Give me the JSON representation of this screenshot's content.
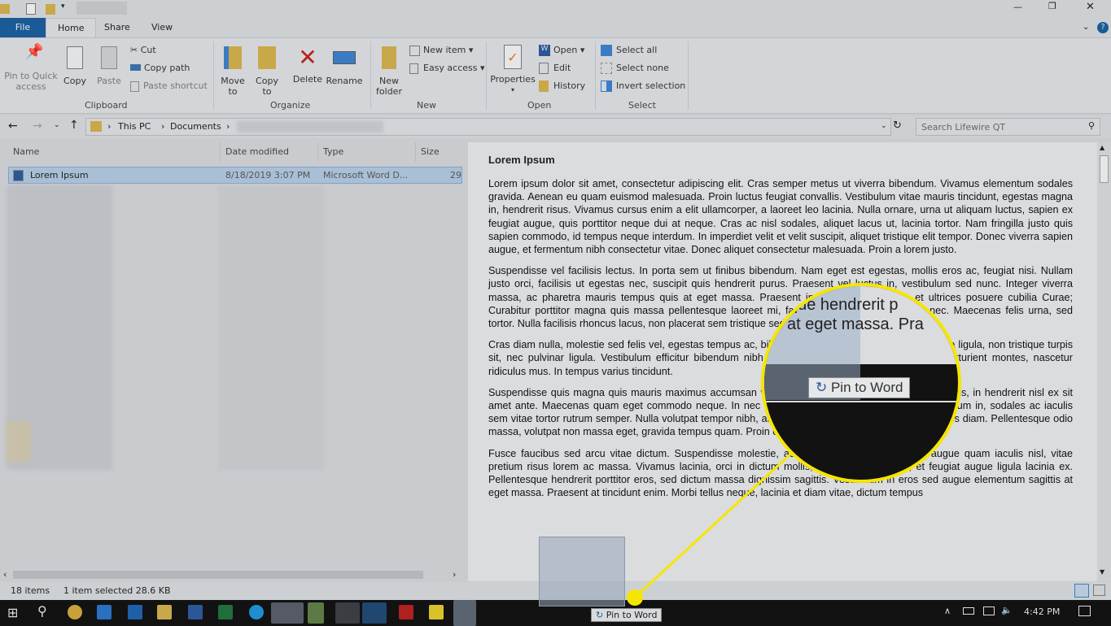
{
  "titlebar": {
    "minimize": "—",
    "restore": "❐",
    "close": "✕"
  },
  "tabs": [
    {
      "label": "File"
    },
    {
      "label": "Home"
    },
    {
      "label": "Share"
    },
    {
      "label": "View"
    }
  ],
  "ribbon": {
    "clipboard": {
      "pin": "Pin to Quick access",
      "copy": "Copy",
      "paste": "Paste",
      "cut": "Cut",
      "copy_path": "Copy path",
      "paste_shortcut": "Paste shortcut",
      "group": "Clipboard"
    },
    "organize": {
      "move": "Move to",
      "copy": "Copy to",
      "delete": "Delete",
      "rename": "Rename",
      "group": "Organize"
    },
    "new": {
      "new_folder": "New folder",
      "new_item": "New item ▾",
      "easy_access": "Easy access ▾",
      "group": "New"
    },
    "open": {
      "properties": "Properties",
      "open": "Open ▾",
      "edit": "Edit",
      "history": "History",
      "group": "Open"
    },
    "select": {
      "select_all": "Select all",
      "select_none": "Select none",
      "invert": "Invert selection",
      "group": "Select"
    }
  },
  "address": {
    "crumbs": [
      "This PC",
      "Documents"
    ],
    "search_placeholder": "Search Lifewire QT"
  },
  "columns": {
    "name": "Name",
    "date": "Date modified",
    "type": "Type",
    "size": "Size"
  },
  "file": {
    "name": "Lorem Ipsum",
    "date": "8/18/2019 3:07 PM",
    "type": "Microsoft Word D...",
    "size": "29"
  },
  "preview": {
    "title": "Lorem Ipsum",
    "paragraphs": [
      "Lorem ipsum dolor sit amet, consectetur adipiscing elit. Cras semper metus ut viverra bibendum. Vivamus elementum sodales gravida. Aenean eu quam euismod malesuada. Proin luctus feugiat convallis. Vestibulum vitae mauris tincidunt, egestas magna in, hendrerit risus. Vivamus cursus enim a elit ullamcorper, a laoreet leo lacinia. Nulla ornare, urna ut aliquam luctus, sapien ex feugiat augue, quis porttitor neque dui at neque. Cras ac nisl sodales, aliquet lacus ut, lacinia tortor. Nam fringilla justo quis sapien commodo, id tempus neque interdum. In imperdiet velit et velit suscipit, aliquet tristique elit tempor. Donec viverra sapien augue, et fermentum nibh consectetur vitae. Donec aliquet consectetur malesuada. Proin a lorem justo.",
      "Suspendisse vel facilisis lectus. In porta sem ut finibus bibendum. Nam eget est egestas, mollis eros ac, feugiat nisi. Nullam justo orci, facilisis ut egestas nec, suscipit quis hendrerit purus. Praesent vel luctus in, vestibulum sed nunc. Integer viverra massa, ac pharetra mauris tempus quis at eget massa. Praesent in faucibus orci luctus et ultrices posuere cubilia Curae; Curabitur porttitor magna quis massa pellentesque laoreet mi, faucibus tincidunt est tristique nec. Maecenas felis urna, sed tortor. Nulla facilisis rhoncus lacus, non placerat sem tristique sed.",
      "Cras diam nulla, molestie sed felis vel, egestas tempus ac, bibendum non leo. Etiam volutpat vehicula ligula, non tristique turpis sit, nec pulvinar ligula. Vestibulum efficitur bibendum nibh, ut mattis sem varius et magnis dis parturient montes, nascetur ridiculus mus. In tempus varius tincidunt.",
      "Suspendisse quis magna quis mauris maximus accumsan vitae tempor hendrerit, velit mi volutpat risus, in hendrerit nisl ex sit amet ante. Maecenas quam eget commodo neque. In nec cursus eros. Nunc quam, mattis eget dictum in, sodales ac iaculis sem vitae tortor rutrum semper. Nulla volutpat tempor nibh, at scelerisque diam lacinia et. Nunc at eros diam. Pellentesque odio massa, volutpat non massa eget, gravida tempus quam. Proin consectetur convallis molestie.",
      "Fusce faucibus sed arcu vitae dictum. Suspendisse molestie, augue eget faucibus euismod, augue quam iaculis nisl, vitae pretium risus lorem ac massa. Vivamus lacinia, orci in dictum mollis, purus rhoncus urna, et feugiat augue ligula lacinia ex. Pellentesque hendrerit porttitor eros, sed dictum massa dignissim sagittis. Vestibulum in eros sed augue elementum sagittis at eget massa. Praesent at tincidunt enim. Morbi tellus neque, lacinia et diam vitae, dictum tempus"
    ]
  },
  "status": {
    "count": "18 items",
    "selected": "1 item selected  28.6 KB"
  },
  "taskbar": {
    "time": "4:42 PM",
    "tooltip": "Pin to Word"
  },
  "magnifier": {
    "text1": "que hendrerit p",
    "text2": "is at eget massa. Pra",
    "tooltip": "Pin to Word"
  },
  "colors": {
    "accent": "#1a5a96",
    "highlight": "#f5e600",
    "taskbar": "#121212"
  }
}
